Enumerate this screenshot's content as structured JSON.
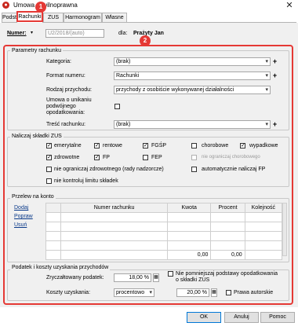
{
  "window": {
    "title": "Umowa cywilnoprawna",
    "badge1": "1",
    "badge2": "2"
  },
  "tabs": [
    {
      "label": "Podstawowe"
    },
    {
      "label": "Rachunki"
    },
    {
      "label": "ZUS"
    },
    {
      "label": "Harmonogram"
    },
    {
      "label": "Własne"
    }
  ],
  "header": {
    "numer_label": "Numer:",
    "numer_value": "U2/2018/(auto)",
    "dla_label": "dla:",
    "dla_value": "Prażyty Jan"
  },
  "params": {
    "group_title": "Parametry rachunku",
    "kategoria_label": "Kategoria:",
    "kategoria_value": "(brak)",
    "format_label": "Format numeru:",
    "format_value": "Rachunki",
    "rodzaj_label": "Rodzaj przychodu:",
    "rodzaj_value": "przychody z osobiście wykonywanej działalności",
    "umowa_label_1": "Umowa o unikaniu",
    "umowa_label_2": "podwójnego",
    "umowa_label_3": "opodatkowania:",
    "tresc_label": "Treść rachunku:",
    "tresc_value": "(brak)"
  },
  "zus": {
    "group_title": "Naliczaj składki ZUS",
    "emerytalne": "emerytalne",
    "rentowe": "rentowe",
    "fgsp": "FGŚP",
    "chorobowe": "chorobowe",
    "wypadkowe": "wypadkowe",
    "zdrowotne": "zdrowotne",
    "fp": "FP",
    "fep": "FEP",
    "nie_ogr_chor": "nie ograniczaj chorobowego",
    "nie_ogr_zdr": "nie ograniczaj zdrowotnego (rady nadzorcze)",
    "automat_fp": "automatycznie naliczaj FP",
    "nie_kontroluj": "nie kontroluj limitu składek"
  },
  "przelew": {
    "group_title": "Przelew na konto",
    "links": [
      "Dodaj",
      "Popraw",
      "Usuń"
    ],
    "columns": [
      "Numer rachunku",
      "Kwota",
      "Procent",
      "Kolejność"
    ],
    "total_kwota": "0,00",
    "total_procent": "0,00"
  },
  "podatek": {
    "group_title": "Podatek i koszty uzyskania przychodów",
    "zryczalt_label": "Zryczałtowany podatek:",
    "zryczalt_value": "18,00 %",
    "nie_pomniejszaj": "Nie pomniejszaj podstawy opodatkowania",
    "nie_pomniejszaj_2": "o składki ZUS",
    "koszty_label": "Koszty uzyskania:",
    "koszty_type": "procentowo",
    "koszty_value": "20,00 %",
    "prawa_autorskie": "Prawa autorskie"
  },
  "buttons": {
    "ok": "OK",
    "cancel": "Anuluj",
    "help": "Pomoc"
  },
  "checks": {
    "emerytalne": true,
    "rentowe": true,
    "fgsp": true,
    "chorobowe": false,
    "wypadkowe": true,
    "zdrowotne": true,
    "fp": true,
    "fep": false,
    "nie_ogr_chor": false,
    "nie_ogr_zdr": false,
    "automat_fp": false,
    "nie_kontroluj": false,
    "umowa": false,
    "nie_pomniejszaj": false,
    "prawa_autorskie": false
  },
  "colors": {
    "highlight": "#e53935",
    "link": "#0a3a8a"
  }
}
